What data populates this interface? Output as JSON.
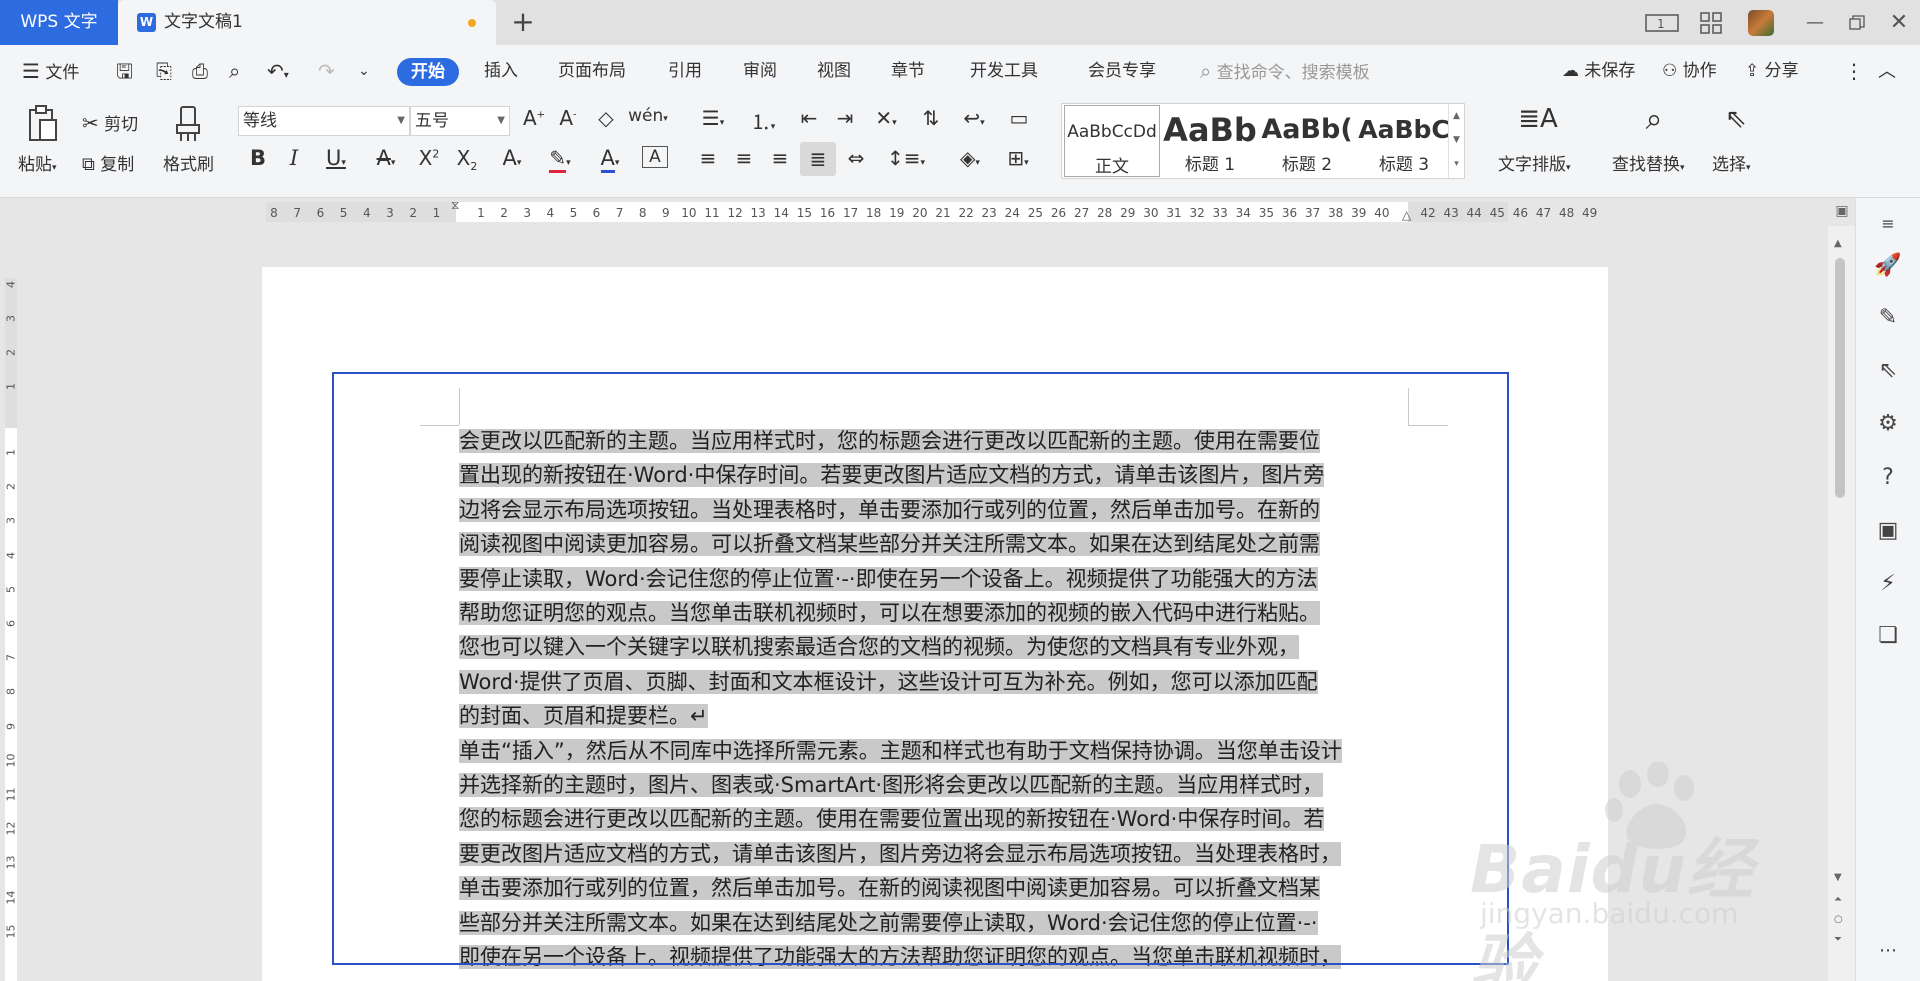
{
  "app": {
    "name": "WPS 文字",
    "doc_tab": "文字文稿1"
  },
  "menu": {
    "file": "文件",
    "tabs": [
      "开始",
      "插入",
      "页面布局",
      "引用",
      "审阅",
      "视图",
      "章节",
      "开发工具",
      "会员专享"
    ],
    "search_placeholder": "查找命令、搜索模板",
    "unsaved": "未保存",
    "collab": "协作",
    "share": "分享"
  },
  "ribbon": {
    "paste": "粘贴",
    "cut": "剪切",
    "copy": "复制",
    "format_painter": "格式刷",
    "font_name": "等线",
    "font_size": "五号",
    "styles": [
      {
        "preview": "AaBbCcDd",
        "name": "正文"
      },
      {
        "preview": "AaBb",
        "name": "标题 1"
      },
      {
        "preview": "AaBb(",
        "name": "标题 2"
      },
      {
        "preview": "AaBbC",
        "name": "标题 3"
      }
    ],
    "text_layout": "文字排版",
    "find_replace": "查找替换",
    "select": "选择"
  },
  "ruler": {
    "left_ticks": [
      "8",
      "7",
      "6",
      "5",
      "4",
      "3",
      "2",
      "1"
    ],
    "right_ticks": [
      "1",
      "2",
      "3",
      "4",
      "5",
      "6",
      "7",
      "8",
      "9",
      "10",
      "11",
      "12",
      "13",
      "14",
      "15",
      "16",
      "17",
      "18",
      "19",
      "20",
      "21",
      "22",
      "23",
      "24",
      "25",
      "26",
      "27",
      "28",
      "29",
      "30",
      "31",
      "32",
      "33",
      "34",
      "35",
      "36",
      "37",
      "38",
      "39",
      "40"
    ],
    "far_ticks": [
      "42",
      "43",
      "44",
      "45",
      "46",
      "47",
      "48",
      "49"
    ],
    "vertical_top": [
      "4",
      "3",
      "2",
      "1"
    ],
    "vertical_body": [
      "1",
      "2",
      "3",
      "4",
      "5",
      "6",
      "7",
      "8",
      "9",
      "10",
      "11",
      "12",
      "13",
      "14",
      "15"
    ]
  },
  "document": {
    "lines": [
      "会更改以匹配新的主题。当应用样式时，您的标题会进行更改以匹配新的主题。使用在需要位",
      "置出现的新按钮在·Word·中保存时间。若要更改图片适应文档的方式，请单击该图片，图片旁",
      "边将会显示布局选项按钮。当处理表格时，单击要添加行或列的位置，然后单击加号。在新的",
      "阅读视图中阅读更加容易。可以折叠文档某些部分并关注所需文本。如果在达到结尾处之前需",
      "要停止读取，Word·会记住您的停止位置·-·即使在另一个设备上。视频提供了功能强大的方法",
      "帮助您证明您的观点。当您单击联机视频时，可以在想要添加的视频的嵌入代码中进行粘贴。",
      "您也可以键入一个关键字以联机搜索最适合您的文档的视频。为使您的文档具有专业外观，",
      "Word·提供了页眉、页脚、封面和文本框设计，这些设计可互为补充。例如，您可以添加匹配",
      "的封面、页眉和提要栏。↵",
      "单击“插入”，然后从不同库中选择所需元素。主题和样式也有助于文档保持协调。当您单击设计",
      "并选择新的主题时，图片、图表或·SmartArt·图形将会更改以匹配新的主题。当应用样式时，",
      "您的标题会进行更改以匹配新的主题。使用在需要位置出现的新按钮在·Word·中保存时间。若",
      "要更改图片适应文档的方式，请单击该图片，图片旁边将会显示布局选项按钮。当处理表格时，",
      "单击要添加行或列的位置，然后单击加号。在新的阅读视图中阅读更加容易。可以折叠文档某",
      "些部分并关注所需文本。如果在达到结尾处之前需要停止读取，Word·会记住您的停止位置·-·",
      "即使在另一个设备上。视频提供了功能强大的方法帮助您证明您的观点。当您单击联机视频时，"
    ]
  },
  "watermark": {
    "brand": "Baidu经验",
    "url": "jingyan.baidu.com"
  },
  "colors": {
    "accent": "#2c6be0",
    "selection": "#c9c9c9",
    "frame": "#2b51c5"
  }
}
